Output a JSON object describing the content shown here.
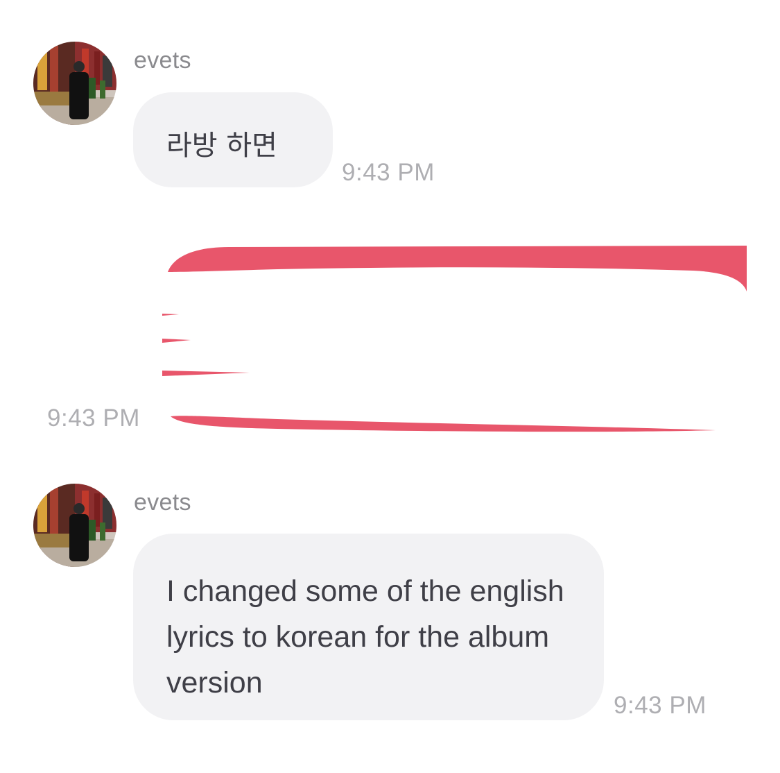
{
  "messages": [
    {
      "sender": "evets",
      "avatar_icon": "profile-photo-icon",
      "text": "라방 하면",
      "time": "9:43 PM"
    },
    {
      "sender": "",
      "outgoing": true,
      "redacted": true,
      "redaction_color": "#e8566b",
      "time": "9:43 PM"
    },
    {
      "sender": "evets",
      "avatar_icon": "profile-photo-icon",
      "text": "I changed some of the english lyrics to korean for the album version",
      "time": "9:43 PM"
    }
  ],
  "colors": {
    "bubble_bg": "#f2f2f4",
    "bubble_text": "#3f3f47",
    "name_text": "#8a8a8e",
    "timestamp_text": "#aeaeb2",
    "redaction": "#e8566b"
  }
}
